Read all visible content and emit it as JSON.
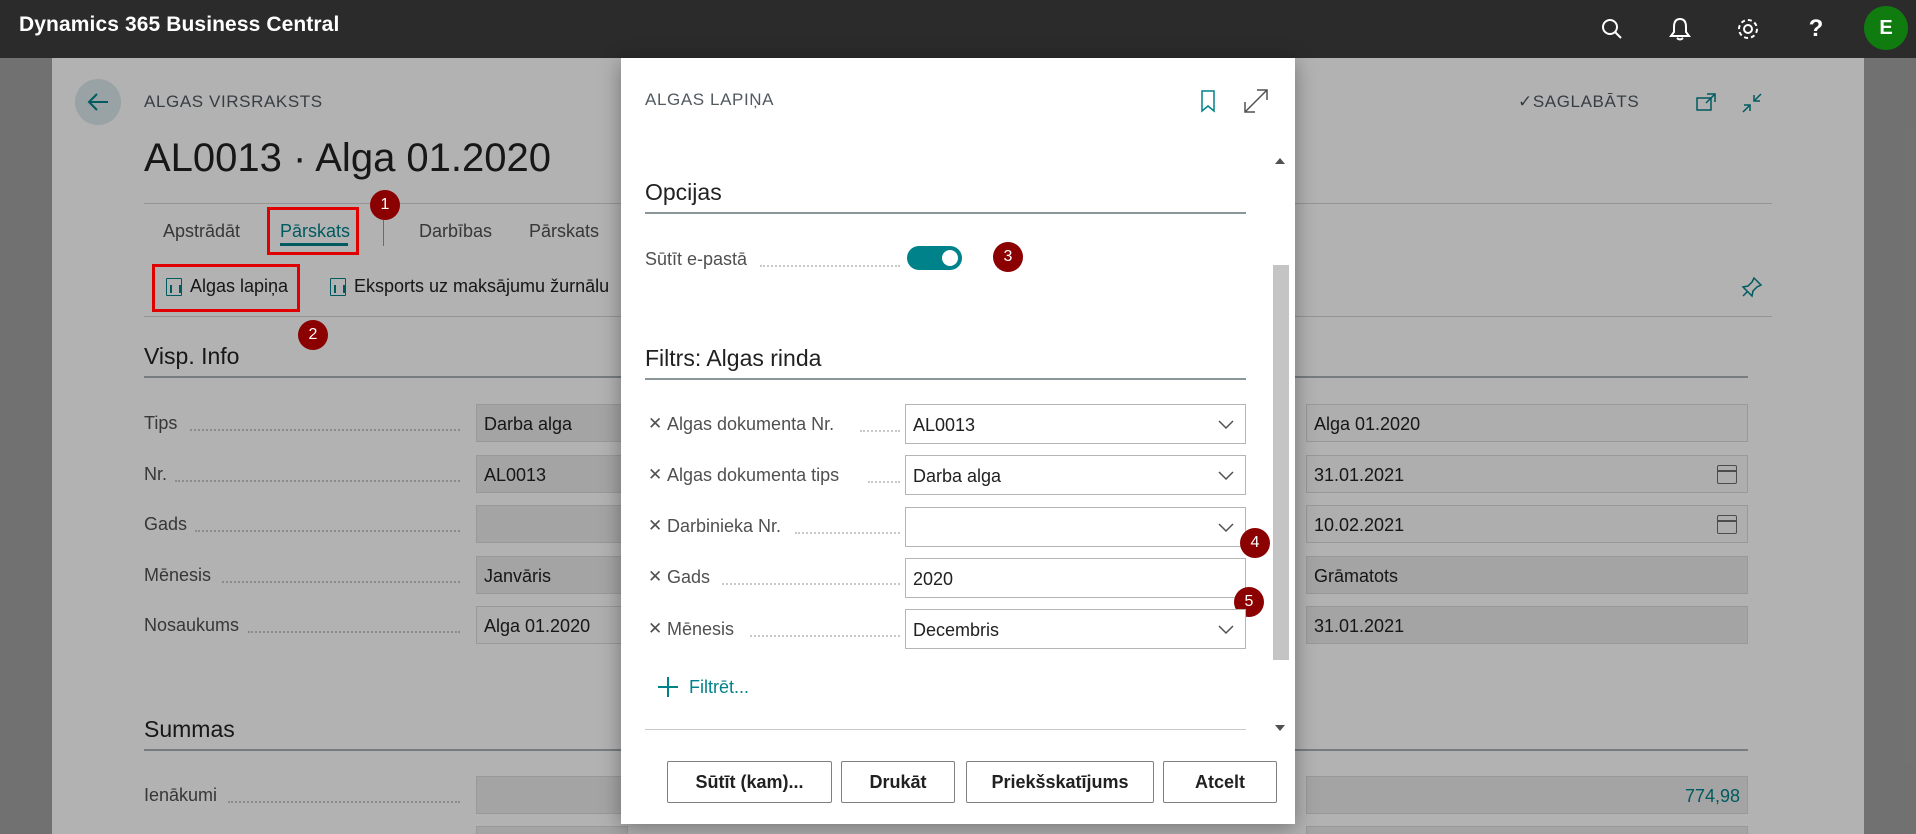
{
  "topbar": {
    "app_title": "Dynamics 365 Business Central",
    "avatar_initial": "E",
    "help_glyph": "?"
  },
  "page": {
    "caption": "ALGAS VIRSRAKSTS",
    "title": "AL0013 · Alga 01.2020",
    "saved_label": "SAGLABĀTS",
    "tabs": [
      "Apstrādāt",
      "Pārskats",
      "Darbības",
      "Pārskats"
    ],
    "actions": [
      "Algas lapiņa",
      "Eksports uz maksājumu žurnālu"
    ],
    "general_section": {
      "title": "Visp. Info",
      "left_fields": [
        {
          "label": "Tips",
          "value": "Darba alga"
        },
        {
          "label": "Nr.",
          "value": "AL0013"
        },
        {
          "label": "Gads",
          "value": ""
        },
        {
          "label": "Mēnesis",
          "value": "Janvāris"
        },
        {
          "label": "Nosaukums",
          "value": "Alga 01.2020"
        }
      ],
      "right_values": [
        "Alga 01.2020",
        "31.01.2021",
        "10.02.2021",
        "Grāmatots",
        "31.01.2021"
      ]
    },
    "summary_section": {
      "title": "Summas",
      "fields": [
        {
          "label": "Ienākumi",
          "value": "774,98"
        }
      ]
    }
  },
  "dialog": {
    "caption": "ALGAS LAPIŅA",
    "options_title": "Opcijas",
    "send_email_label": "Sūtīt e-pastā",
    "send_email_on": true,
    "filter_title": "Filtrs: Algas rinda",
    "filters": [
      {
        "label": "Algas dokumenta Nr.",
        "value": "AL0013"
      },
      {
        "label": "Algas dokumenta tips",
        "value": "Darba alga"
      },
      {
        "label": "Darbinieka Nr.",
        "value": ""
      },
      {
        "label": "Gads",
        "value": "2020"
      },
      {
        "label": "Mēnesis",
        "value": "Decembris"
      }
    ],
    "add_filter_label": "Filtrēt...",
    "buttons": [
      "Sūtīt (kam)...",
      "Drukāt",
      "Priekšskatījums",
      "Atcelt"
    ]
  },
  "annotations": [
    "1",
    "2",
    "3",
    "4",
    "5"
  ],
  "colors": {
    "accent": "#00828a",
    "topbar": "#2b2b2b",
    "annotation": "#8b0000",
    "highlight": "#e00000"
  }
}
